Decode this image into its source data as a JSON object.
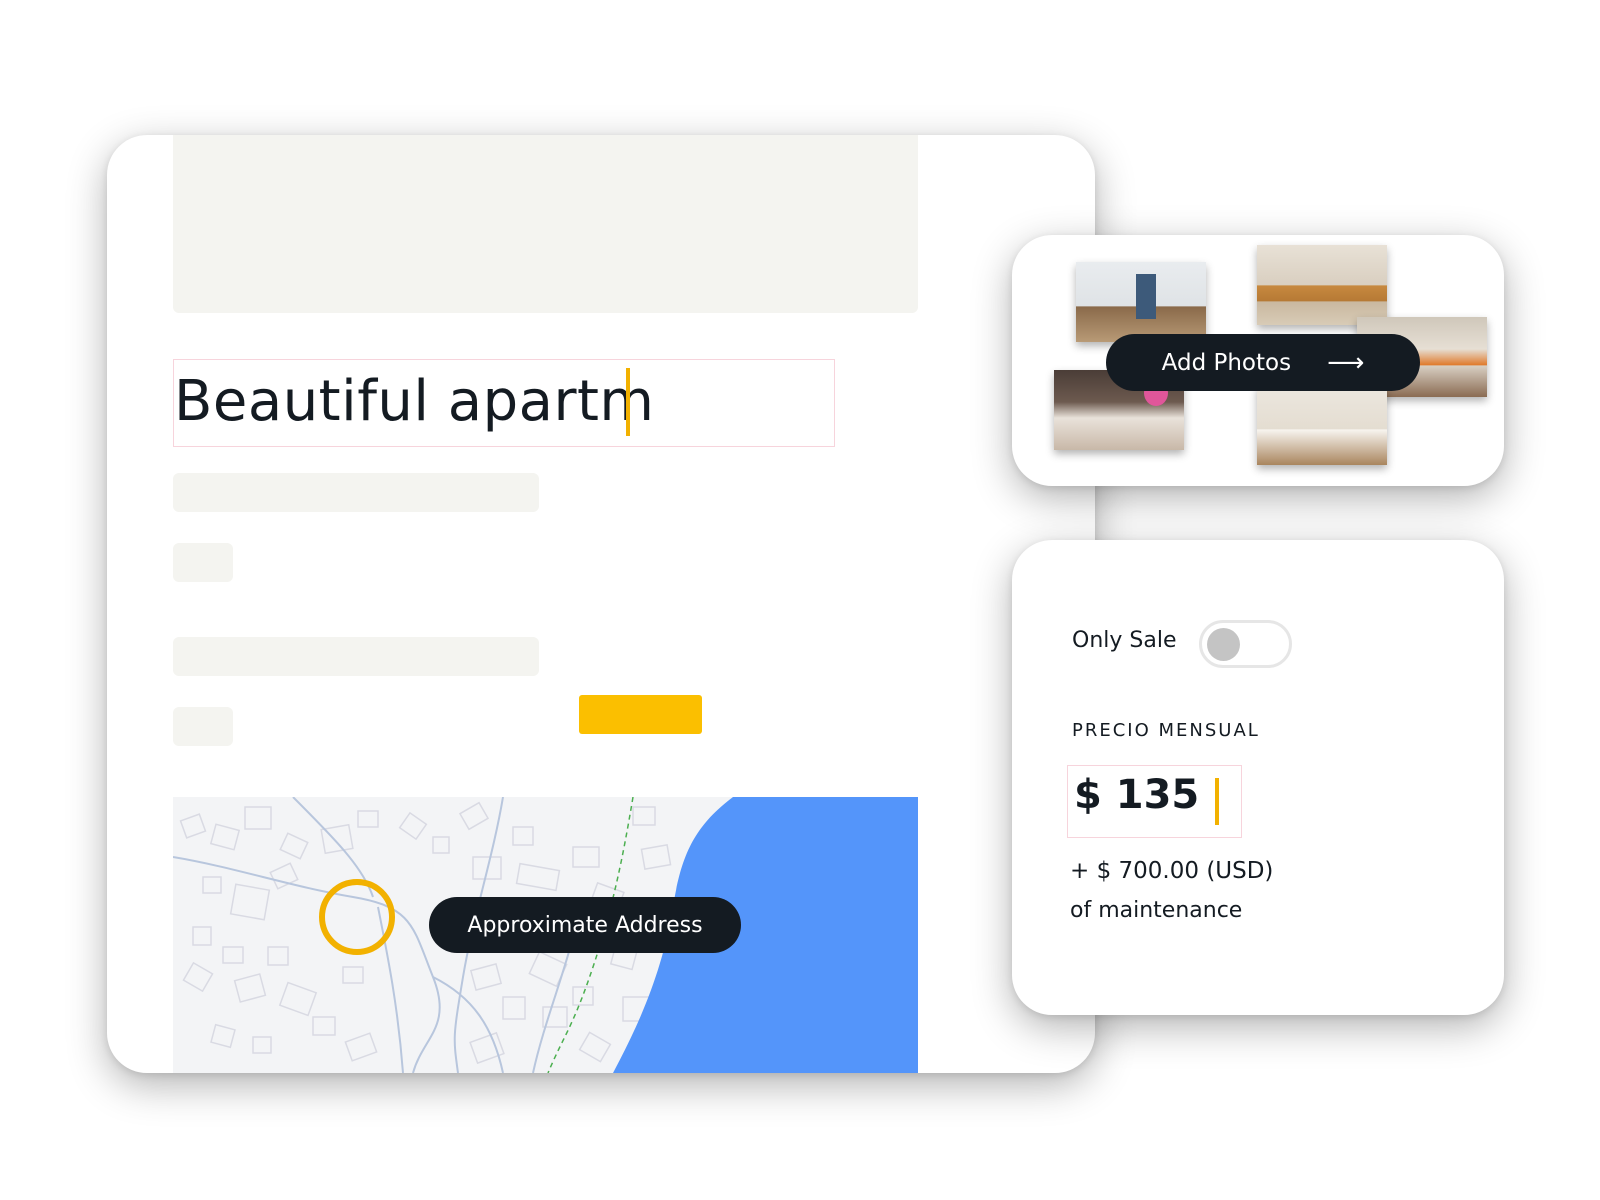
{
  "listing": {
    "title_value": "Beautiful apartm"
  },
  "map": {
    "address_label": "Approximate Address"
  },
  "photos": {
    "add_label": "Add Photos",
    "arrow_icon": "arrow-right-icon",
    "thumbnails": [
      "living-room-photo",
      "lounge-photo",
      "kitchen-photo",
      "sofa-flowers-photo",
      "bedroom-photo",
      "office-photo"
    ]
  },
  "pricing": {
    "only_sale_label": "Only Sale",
    "only_sale_on": false,
    "section_label": "PRECIO MENSUAL",
    "price_value": "$ 135",
    "maintenance_amount": "+ $ 700.00 (USD)",
    "maintenance_text": "of maintenance"
  },
  "colors": {
    "accent": "#fbbf00",
    "dark": "#141b22",
    "water": "#5495fa",
    "field_border": "#f7d4dc"
  }
}
